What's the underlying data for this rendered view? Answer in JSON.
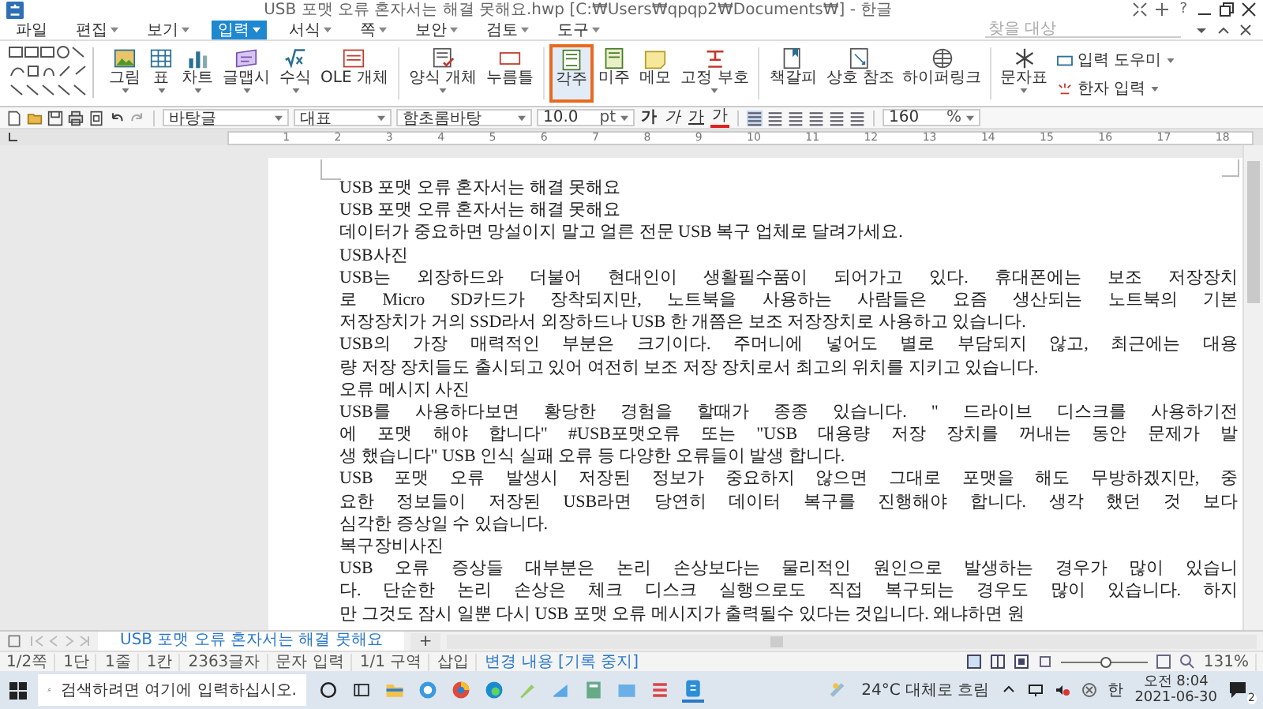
{
  "window": {
    "title": "USB 포맷 오류 혼자서는 해결 못해요.hwp [C:₩Users₩qpqp2₩Documents₩] - 한글",
    "help": "?"
  },
  "menu": [
    {
      "label": "파일",
      "selected": false,
      "dropdown": false
    },
    {
      "label": "편집",
      "selected": false,
      "dropdown": true
    },
    {
      "label": "보기",
      "selected": false,
      "dropdown": true
    },
    {
      "label": "입력",
      "selected": true,
      "dropdown": true
    },
    {
      "label": "서식",
      "selected": false,
      "dropdown": true
    },
    {
      "label": "쪽",
      "selected": false,
      "dropdown": true
    },
    {
      "label": "보안",
      "selected": false,
      "dropdown": true
    },
    {
      "label": "검토",
      "selected": false,
      "dropdown": true
    },
    {
      "label": "도구",
      "selected": false,
      "dropdown": true
    }
  ],
  "search": {
    "placeholder": "찾을 대상"
  },
  "ribbon": [
    {
      "label": "그림",
      "selected": false,
      "dropdown": true
    },
    {
      "label": "표",
      "selected": false,
      "dropdown": true
    },
    {
      "label": "차트",
      "selected": false,
      "dropdown": true
    },
    {
      "label": "글맵시",
      "selected": false,
      "dropdown": true
    },
    {
      "label": "수식",
      "selected": false,
      "dropdown": true
    },
    {
      "label": "OLE 개체",
      "selected": false,
      "dropdown": false
    },
    {
      "label": "양식 개체",
      "selected": false,
      "dropdown": true
    },
    {
      "label": "누름틀",
      "selected": false,
      "dropdown": false
    },
    {
      "label": "각주",
      "selected": true,
      "dropdown": false
    },
    {
      "label": "미주",
      "selected": false,
      "dropdown": false
    },
    {
      "label": "메모",
      "selected": false,
      "dropdown": false
    },
    {
      "label": "고정 부호",
      "selected": false,
      "dropdown": true
    },
    {
      "label": "책갈피",
      "selected": false,
      "dropdown": false
    },
    {
      "label": "상호 참조",
      "selected": false,
      "dropdown": false
    },
    {
      "label": "하이퍼링크",
      "selected": false,
      "dropdown": false
    },
    {
      "label": "문자표",
      "selected": false,
      "dropdown": true
    }
  ],
  "ribbon_small": [
    {
      "label": "입력 도우미"
    },
    {
      "label": "한자 입력"
    }
  ],
  "toolbar": {
    "style": "바탕글",
    "language": "대표",
    "font": "함초롬바탕",
    "size": "10.0",
    "unit": "pt",
    "letters": [
      "가",
      "가",
      "가",
      "가"
    ],
    "line_spacing": "160",
    "percent": "%"
  },
  "ruler": {
    "ticks": [
      "1",
      "2",
      "3",
      "4",
      "5",
      "6",
      "7",
      "8",
      "9",
      "10",
      "11",
      "12",
      "13",
      "14",
      "15",
      "16",
      "17",
      "18"
    ]
  },
  "document": {
    "paragraphs": [
      {
        "lines": [
          "USB 포맷 오류 혼자서는 해결 못해요"
        ]
      },
      {
        "lines": [
          "USB 포맷 오류 혼자서는 해결 못해요"
        ]
      },
      {
        "lines": [
          "데이터가 중요하면 망설이지 말고 얼른 전문 USB 복구 업체로 달려가세요."
        ]
      },
      {
        "lines": [
          "USB사진"
        ]
      },
      {
        "lines": [
          "USB는 외장하드와 더불어 현대인이 생활필수품이 되어가고 있다. 휴대폰에는 보조 저장장치",
          "로 Micro SD카드가 장착되지만, 노트북을 사용하는 사람들은 요즘 생산되는 노트북의 기본",
          "저장장치가 거의 SSD라서 외장하드나 USB 한 개쯤은 보조 저장장치로 사용하고 있습니다."
        ]
      },
      {
        "lines": [
          "USB의 가장 매력적인 부분은 크기이다. 주머니에 넣어도 별로 부담되지 않고, 최근에는 대용",
          "량 저장 장치들도 출시되고 있어 여전히 보조 저장 장치로서 최고의 위치를 지키고 있습니다."
        ]
      },
      {
        "lines": [
          "오류 메시지 사진"
        ]
      },
      {
        "lines": [
          "USB를 사용하다보면 황당한 경험을 할때가 종종 있습니다. \" 드라이브 디스크를 사용하기전",
          "에 포맷 해야 합니다\" #USB포맷오류 또는 \"USB 대용량 저장 장치를 꺼내는 동안 문제가 발",
          "생 했습니다\" USB 인식 실패 오류 등 다양한 오류들이 발생 합니다."
        ]
      },
      {
        "lines": [
          "USB 포맷 오류 발생시 저장된 정보가 중요하지 않으면 그대로 포맷을 해도 무방하겠지만, 중",
          "요한 정보들이 저장된 USB라면 당연히 데이터 복구를 진행해야 합니다. 생각 했던 것 보다",
          "심각한 증상일 수 있습니다."
        ]
      },
      {
        "lines": [
          "복구장비사진"
        ]
      },
      {
        "lines": [
          "USB 오류 증상들 대부분은 논리 손상보다는 물리적인 원인으로 발생하는 경우가 많이 있습니",
          "다. 단순한 논리 손상은 체크 디스크 실행으로도 직접 복구되는 경우도 많이 있습니다. 하지",
          "만 그것도 잠시 일뿐 다시 USB 포맷 오류 메시지가 출력될수 있다는 것입니다. 왜냐하면 원"
        ]
      }
    ]
  },
  "tabs": [
    {
      "label": "USB 포맷 오류 혼자서는 해결 못해요",
      "selected": true
    }
  ],
  "new_tab": "+",
  "status_bar": {
    "items": [
      "1/2쪽",
      "1단",
      "1줄",
      "1칸",
      "2363글자",
      "문자 입력",
      "1/1 구역",
      "삽입"
    ],
    "track_changes": "변경 내용 [기록 중지]",
    "zoom": {
      "level": 0.5,
      "reading": "131%"
    }
  },
  "taskbar": {
    "search_placeholder": "검색하려면 여기에 입력하십시오.",
    "weather": "24°C 대체로 흐림",
    "ime": "한",
    "time": "오전 8:04",
    "date": "2021-06-30",
    "notifications": "2"
  }
}
